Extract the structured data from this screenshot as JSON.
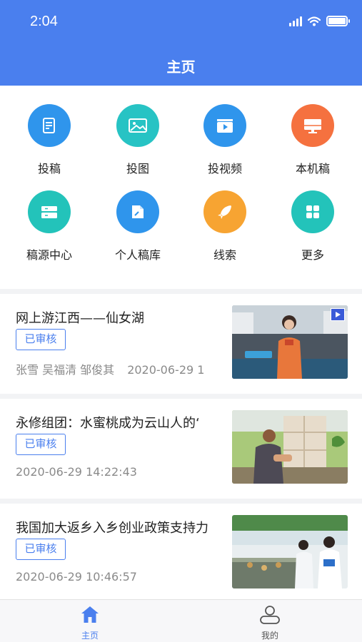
{
  "status_bar": {
    "time": "2:04"
  },
  "header": {
    "title": "主页"
  },
  "grid": [
    {
      "label": "投稿",
      "icon": "document-edit-icon",
      "color": "#2f95ec"
    },
    {
      "label": "投图",
      "icon": "image-icon",
      "color": "#27c3c4"
    },
    {
      "label": "投视频",
      "icon": "video-icon",
      "color": "#2f95ec"
    },
    {
      "label": "本机稿",
      "icon": "monitor-icon",
      "color": "#f5713f"
    },
    {
      "label": "稿源中心",
      "icon": "inbox-icon",
      "color": "#23c3ba"
    },
    {
      "label": "个人稿库",
      "icon": "folder-edit-icon",
      "color": "#2f95ec"
    },
    {
      "label": "线索",
      "icon": "rocket-icon",
      "color": "#f7a432"
    },
    {
      "label": "更多",
      "icon": "apps-grid-icon",
      "color": "#23c3ba"
    }
  ],
  "news": [
    {
      "title": "网上游江西——仙女湖",
      "status": "已审核",
      "authors": "张雪 吴福清 邹俊其",
      "time": "2020-06-29 1",
      "thumb": "video-thumbnail",
      "is_video": true
    },
    {
      "title": "永修组团：水蜜桃成为云山人的‘",
      "status": "已审核",
      "authors": "",
      "time": "2020-06-29 14:22:43",
      "thumb": "peach-farmer-photo",
      "is_video": false
    },
    {
      "title": "我国加大返乡入乡创业政策支持力",
      "status": "已审核",
      "authors": "",
      "time": "2020-06-29 10:46:57",
      "thumb": "workers-food-stall-photo",
      "is_video": false
    }
  ],
  "tabbar": {
    "home_label": "主页",
    "mine_label": "我的",
    "active_color": "#4a7fee",
    "inactive_color": "#555555"
  }
}
